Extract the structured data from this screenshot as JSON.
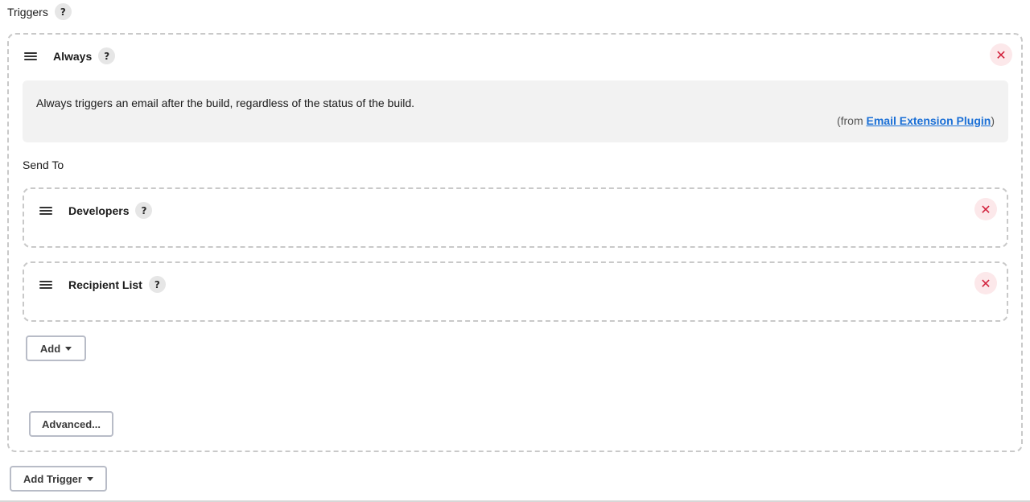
{
  "triggers": {
    "label": "Triggers",
    "help": "?",
    "add_trigger_label": "Add Trigger"
  },
  "always": {
    "title": "Always",
    "help": "?",
    "close": "✕",
    "description": "Always triggers an email after the build, regardless of the status of the build.",
    "from_prefix": "(from ",
    "from_link": "Email Extension Plugin",
    "from_suffix": ")",
    "send_to_label": "Send To",
    "recipients": [
      {
        "title": "Developers",
        "help": "?",
        "close": "✕"
      },
      {
        "title": "Recipient List",
        "help": "?",
        "close": "✕"
      }
    ],
    "add_label": "Add",
    "advanced_label": "Advanced..."
  }
}
